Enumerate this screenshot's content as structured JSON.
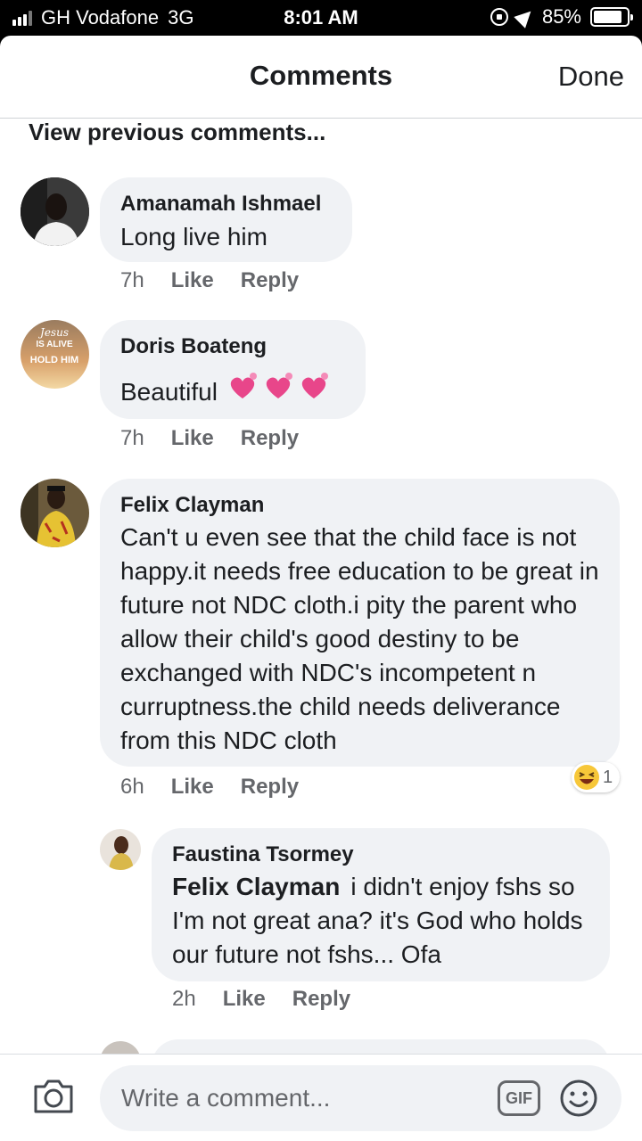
{
  "status": {
    "carrier": "GH Vodafone",
    "network": "3G",
    "time": "8:01 AM",
    "battery": "85%",
    "battery_level": 0.85
  },
  "header": {
    "title": "Comments",
    "done": "Done"
  },
  "view_previous": "View previous comments...",
  "comments": [
    {
      "author": "Amanamah Ishmael",
      "text": "Long live him",
      "time": "7h",
      "like": "Like",
      "reply": "Reply"
    },
    {
      "author": "Doris Boateng",
      "text": "Beautiful",
      "time": "7h",
      "like": "Like",
      "reply": "Reply",
      "avatar_text": [
        "Jesus",
        "IS ALIVE",
        "HOLD HIM"
      ]
    },
    {
      "author": "Felix Clayman",
      "text": "Can't u even see that the child face is not happy.it needs free education to be great in future not NDC cloth.i pity the parent who allow their child's good destiny to be exchanged with NDC's incompetent n curruptness.the child needs deliverance from this NDC cloth",
      "time": "6h",
      "like": "Like",
      "reply": "Reply",
      "reaction_count": "1"
    },
    {
      "author": "Faustina Tsormey",
      "mention": "Felix Clayman",
      "text": "i didn't enjoy fshs so I'm not great ana? it's God who holds our future not fshs... Ofa",
      "time": "2h",
      "like": "Like",
      "reply": "Reply"
    }
  ],
  "composer": {
    "placeholder": "Write a comment...",
    "gif": "GIF"
  },
  "colors": {
    "bubble": "#f0f2f5",
    "text": "#1c1e21",
    "meta": "#65676b",
    "heart": "#e8468a"
  }
}
